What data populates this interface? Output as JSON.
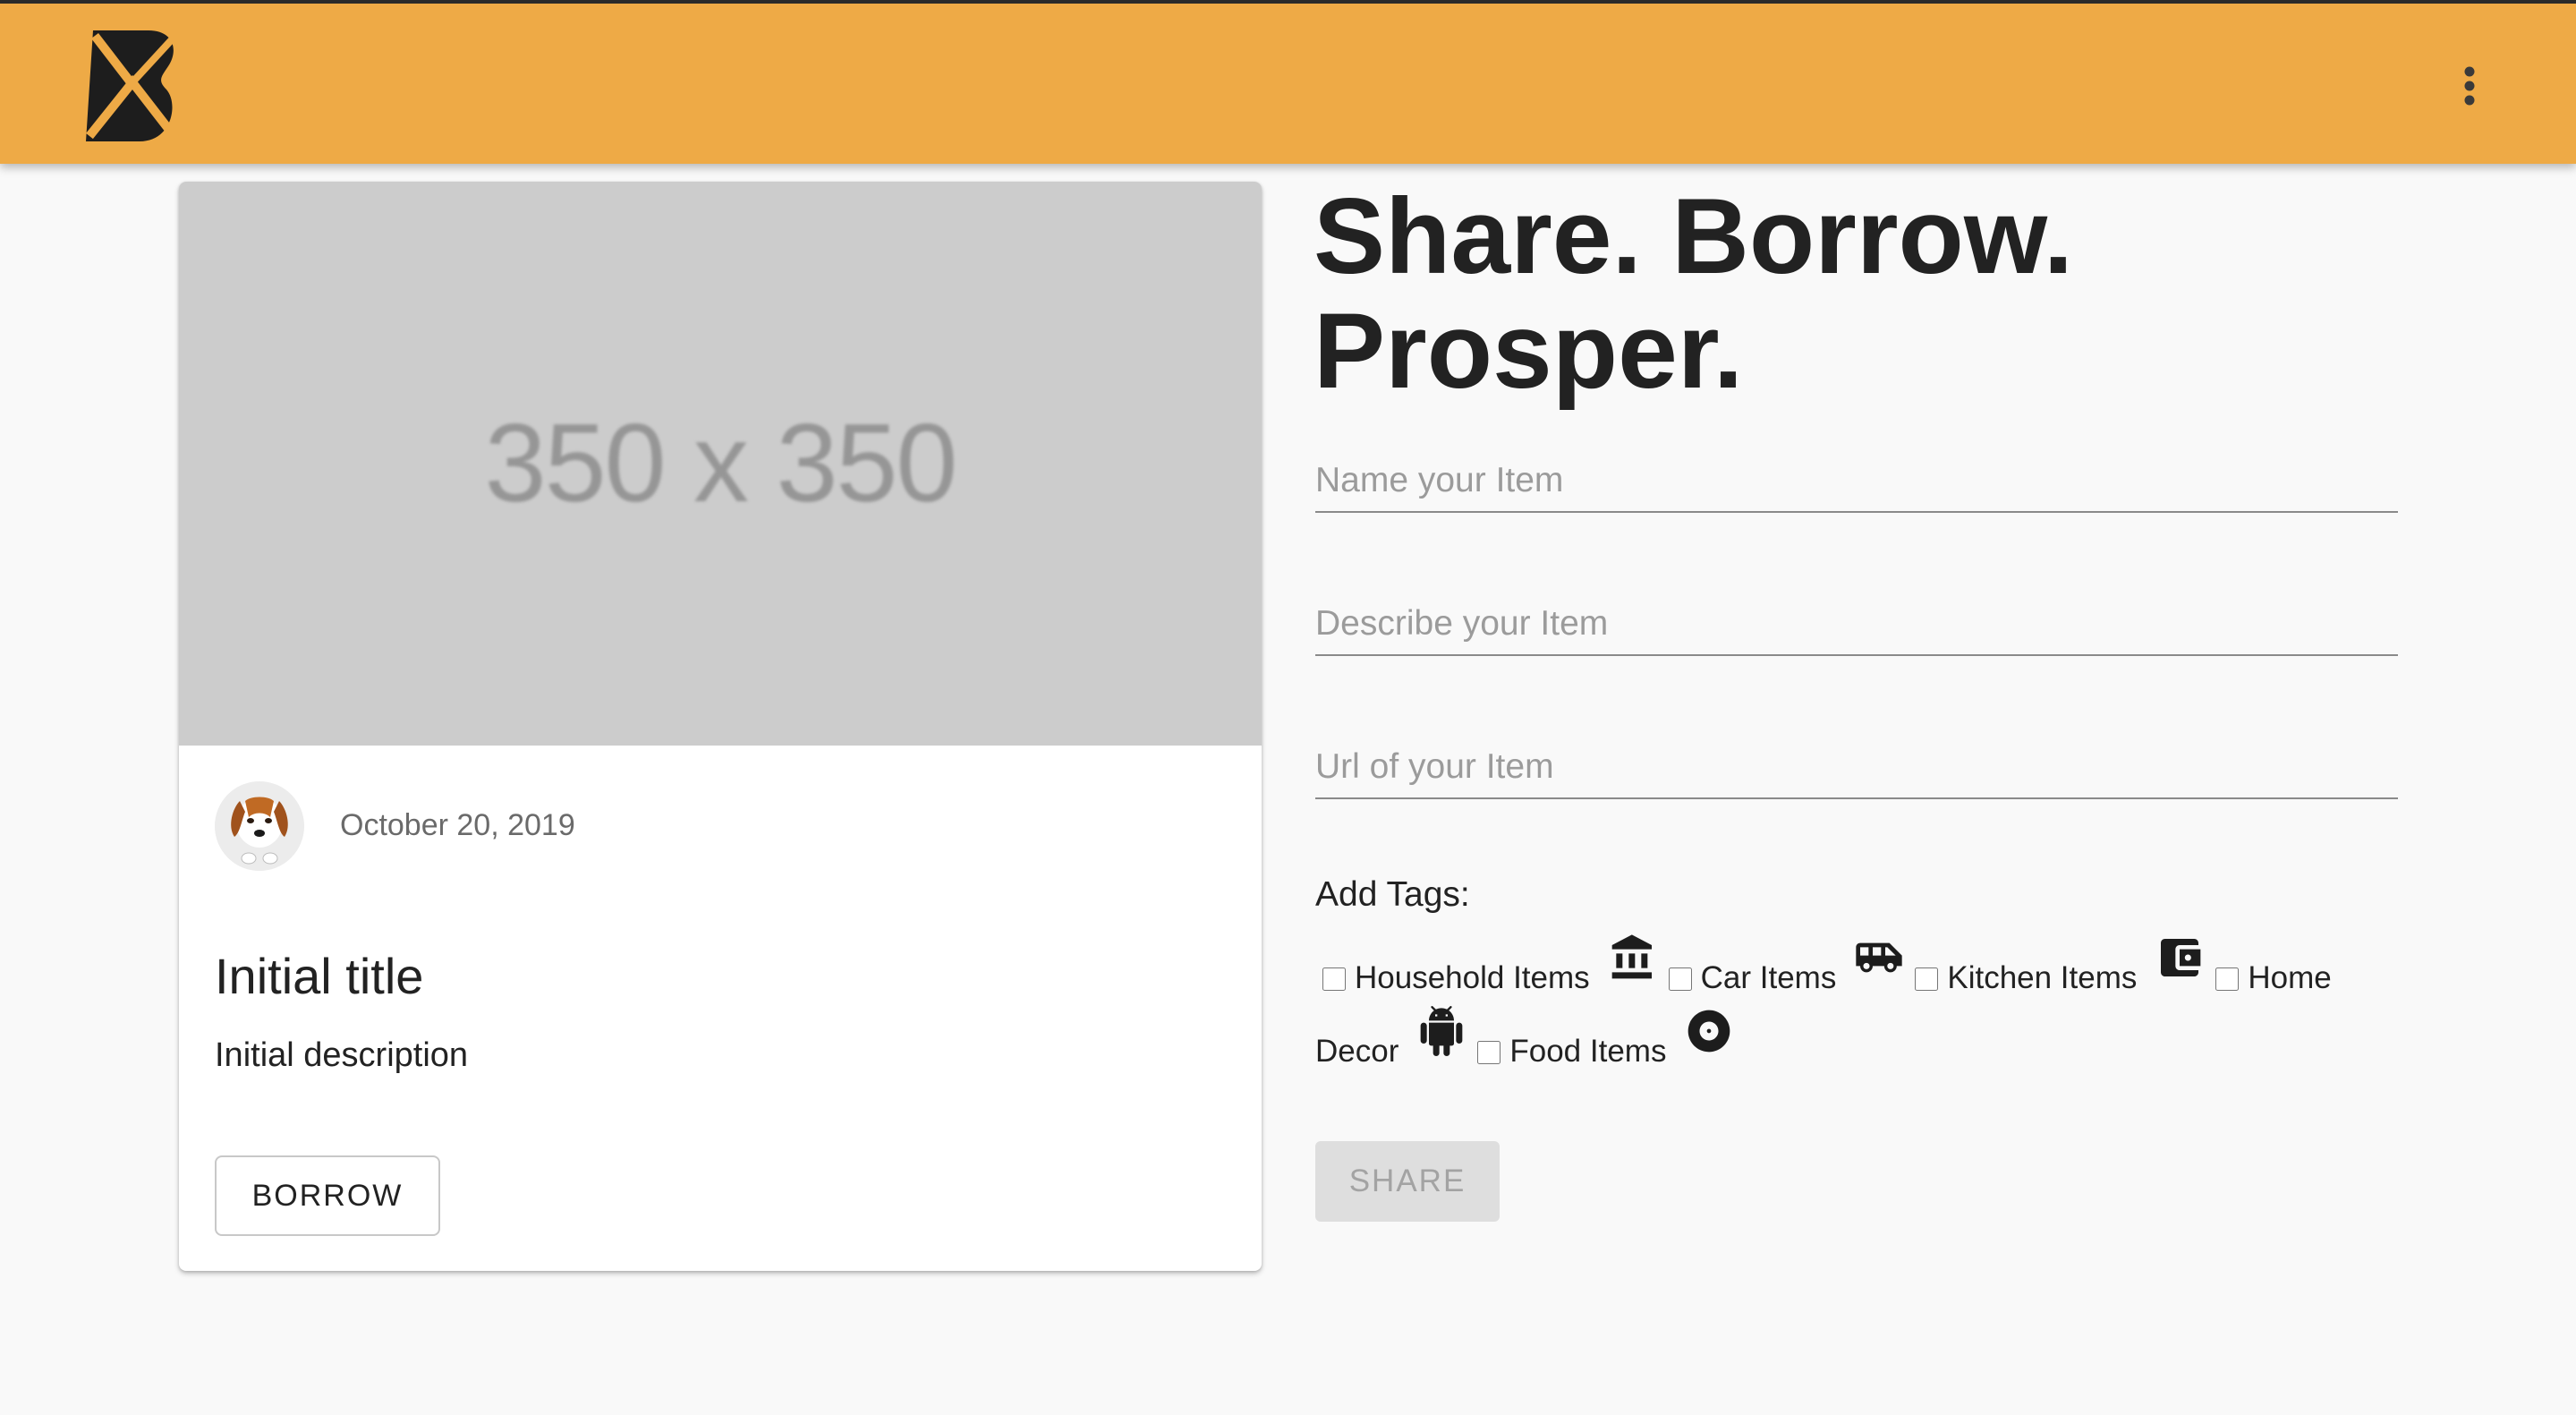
{
  "app": {
    "brand_color": "#eeaa46",
    "logo_icon": "boomtown-logo-icon",
    "menu_icon": "more-vert-icon"
  },
  "card": {
    "image_placeholder": "350 x 350",
    "avatar_icon": "beagle-avatar",
    "date": "October 20, 2019",
    "title": "Initial title",
    "description": "Initial description",
    "borrow_label": "BORROW"
  },
  "form": {
    "headline_line1": "Share. Borrow.",
    "headline_line2": "Prosper.",
    "name_placeholder": "Name your Item",
    "description_placeholder": "Describe your Item",
    "url_placeholder": "Url of your Item",
    "tags_label": "Add Tags:",
    "tags": [
      {
        "label": "Household Items",
        "icon": "account-balance-icon"
      },
      {
        "label": "Car Items",
        "icon": "airport-shuttle-icon"
      },
      {
        "label": "Kitchen Items",
        "icon": "account-balance-wallet-icon"
      },
      {
        "label": "Home Decor",
        "icon": "android-icon"
      },
      {
        "label": "Food Items",
        "icon": "album-icon"
      }
    ],
    "share_label": "SHARE"
  }
}
